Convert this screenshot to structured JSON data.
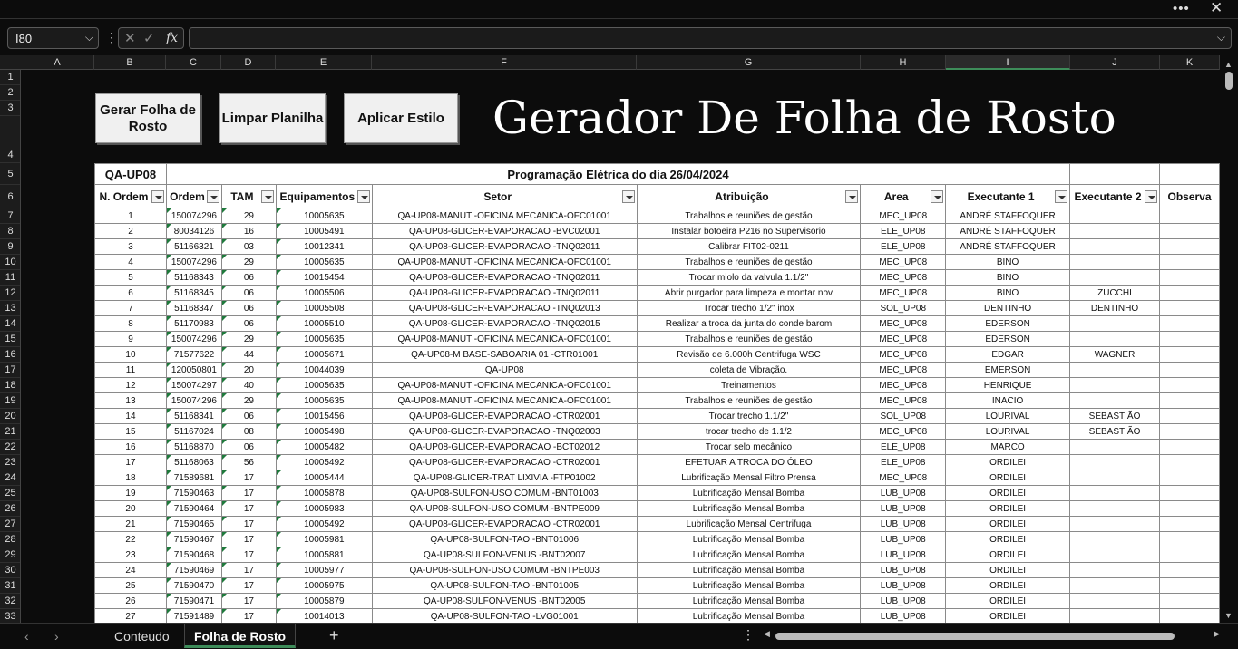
{
  "formula_bar": {
    "name_box": "I80",
    "fx_label": "fx"
  },
  "columns": [
    "A",
    "B",
    "C",
    "D",
    "E",
    "F",
    "G",
    "H",
    "I",
    "J",
    "K"
  ],
  "selected_column": "I",
  "row_numbers": [
    "1",
    "2",
    "3",
    "4",
    "5",
    "6",
    "7",
    "8",
    "9",
    "10",
    "11",
    "12",
    "13",
    "14",
    "15",
    "16",
    "17",
    "18",
    "19",
    "20",
    "21",
    "22",
    "23",
    "24",
    "25",
    "26",
    "27",
    "28",
    "29",
    "30",
    "31",
    "32",
    "33"
  ],
  "buttons": {
    "gerar": "Gerar Folha de Rosto",
    "limpar": "Limpar Planilha",
    "aplicar": "Aplicar Estilo"
  },
  "title": "Gerador De Folha de Rosto",
  "header": {
    "unit": "QA-UP08",
    "programacao": "Programação Elétrica do dia 26/04/2024"
  },
  "table_headers": [
    "N. Ordem",
    "Ordem",
    "TAM",
    "Equipamentos",
    "Setor",
    "Atribuição",
    "Area",
    "Executante 1",
    "Executante 2",
    "Observa"
  ],
  "rows": [
    [
      "1",
      "150074296",
      "29",
      "10005635",
      "QA-UP08-MANUT -OFICINA MECANICA-OFC01001",
      "Trabalhos e reuniões de gestão",
      "MEC_UP08",
      "ANDRÉ STAFFOQUER",
      ""
    ],
    [
      "2",
      "80034126",
      "16",
      "10005491",
      "QA-UP08-GLICER-EVAPORACAO    -BVC02001",
      "Instalar botoeira P216 no Supervisorio",
      "ELE_UP08",
      "ANDRÉ STAFFOQUER",
      ""
    ],
    [
      "3",
      "51166321",
      "03",
      "10012341",
      "QA-UP08-GLICER-EVAPORACAO    -TNQ02011",
      "Calibrar FIT02-0211",
      "ELE_UP08",
      "ANDRÉ STAFFOQUER",
      ""
    ],
    [
      "4",
      "150074296",
      "29",
      "10005635",
      "QA-UP08-MANUT -OFICINA MECANICA-OFC01001",
      "Trabalhos e reuniões de gestão",
      "MEC_UP08",
      "BINO",
      ""
    ],
    [
      "5",
      "51168343",
      "06",
      "10015454",
      "QA-UP08-GLICER-EVAPORACAO    -TNQ02011",
      "Trocar miolo da valvula 1.1/2\"",
      "MEC_UP08",
      "BINO",
      ""
    ],
    [
      "6",
      "51168345",
      "06",
      "10005506",
      "QA-UP08-GLICER-EVAPORACAO    -TNQ02011",
      "Abrir purgador para limpeza e montar nov",
      "MEC_UP08",
      "BINO",
      "ZUCCHI"
    ],
    [
      "7",
      "51168347",
      "06",
      "10005508",
      "QA-UP08-GLICER-EVAPORACAO    -TNQ02013",
      "Trocar trecho 1/2\" inox",
      "SOL_UP08",
      "DENTINHO",
      "DENTINHO"
    ],
    [
      "8",
      "51170983",
      "06",
      "10005510",
      "QA-UP08-GLICER-EVAPORACAO    -TNQ02015",
      "Realizar a troca da junta do conde barom",
      "MEC_UP08",
      "EDERSON",
      ""
    ],
    [
      "9",
      "150074296",
      "29",
      "10005635",
      "QA-UP08-MANUT -OFICINA MECANICA-OFC01001",
      "Trabalhos e reuniões de gestão",
      "MEC_UP08",
      "EDERSON",
      ""
    ],
    [
      "10",
      "71577622",
      "44",
      "10005671",
      "QA-UP08-M BASE-SABOARIA 01    -CTR01001",
      "Revisão de 6.000h Centrifuga WSC",
      "MEC_UP08",
      "EDGAR",
      "WAGNER"
    ],
    [
      "11",
      "120050801",
      "20",
      "10044039",
      "QA-UP08",
      "coleta de Vibração.",
      "MEC_UP08",
      "EMERSON",
      ""
    ],
    [
      "12",
      "150074297",
      "40",
      "10005635",
      "QA-UP08-MANUT -OFICINA MECANICA-OFC01001",
      "Treinamentos",
      "MEC_UP08",
      "HENRIQUE",
      ""
    ],
    [
      "13",
      "150074296",
      "29",
      "10005635",
      "QA-UP08-MANUT -OFICINA MECANICA-OFC01001",
      "Trabalhos e reuniões de gestão",
      "MEC_UP08",
      "INACIO",
      ""
    ],
    [
      "14",
      "51168341",
      "06",
      "10015456",
      "QA-UP08-GLICER-EVAPORACAO    -CTR02001",
      "Trocar trecho 1.1/2\"",
      "SOL_UP08",
      "LOURIVAL",
      "SEBASTIÃO"
    ],
    [
      "15",
      "51167024",
      "08",
      "10005498",
      "QA-UP08-GLICER-EVAPORACAO    -TNQ02003",
      "trocar trecho de 1.1/2",
      "MEC_UP08",
      "LOURIVAL",
      "SEBASTIÃO"
    ],
    [
      "16",
      "51168870",
      "06",
      "10005482",
      "QA-UP08-GLICER-EVAPORACAO    -BCT02012",
      "Trocar selo mecânico",
      "ELE_UP08",
      "MARCO",
      ""
    ],
    [
      "17",
      "51168063",
      "56",
      "10005492",
      "QA-UP08-GLICER-EVAPORACAO    -CTR02001",
      "EFETUAR A TROCA DO ÓLEO",
      "ELE_UP08",
      "ORDILEI",
      ""
    ],
    [
      "18",
      "71589681",
      "17",
      "10005444",
      "QA-UP08-GLICER-TRAT LIXIVIA   -FTP01002",
      "Lubrificação Mensal Filtro Prensa",
      "MEC_UP08",
      "ORDILEI",
      ""
    ],
    [
      "19",
      "71590463",
      "17",
      "10005878",
      "QA-UP08-SULFON-USO COMUM     -BNT01003",
      "Lubrificação Mensal Bomba",
      "LUB_UP08",
      "ORDILEI",
      ""
    ],
    [
      "20",
      "71590464",
      "17",
      "10005983",
      "QA-UP08-SULFON-USO COMUM     -BNTPE009",
      "Lubrificação Mensal Bomba",
      "LUB_UP08",
      "ORDILEI",
      ""
    ],
    [
      "21",
      "71590465",
      "17",
      "10005492",
      "QA-UP08-GLICER-EVAPORACAO    -CTR02001",
      "Lubrificação Mensal Centrifuga",
      "LUB_UP08",
      "ORDILEI",
      ""
    ],
    [
      "22",
      "71590467",
      "17",
      "10005981",
      "QA-UP08-SULFON-TAO          -BNT01006",
      "Lubrificação Mensal Bomba",
      "LUB_UP08",
      "ORDILEI",
      ""
    ],
    [
      "23",
      "71590468",
      "17",
      "10005881",
      "QA-UP08-SULFON-VENUS        -BNT02007",
      "Lubrificação Mensal Bomba",
      "LUB_UP08",
      "ORDILEI",
      ""
    ],
    [
      "24",
      "71590469",
      "17",
      "10005977",
      "QA-UP08-SULFON-USO COMUM     -BNTPE003",
      "Lubrificação Mensal Bomba",
      "LUB_UP08",
      "ORDILEI",
      ""
    ],
    [
      "25",
      "71590470",
      "17",
      "10005975",
      "QA-UP08-SULFON-TAO          -BNT01005",
      "Lubrificação Mensal Bomba",
      "LUB_UP08",
      "ORDILEI",
      ""
    ],
    [
      "26",
      "71590471",
      "17",
      "10005879",
      "QA-UP08-SULFON-VENUS        -BNT02005",
      "Lubrificação Mensal Bomba",
      "LUB_UP08",
      "ORDILEI",
      ""
    ],
    [
      "27",
      "71591489",
      "17",
      "10014013",
      "QA-UP08-SULFON-TAO          -LVG01001",
      "Lubrificação Mensal Bomba",
      "LUB_UP08",
      "ORDILEI",
      ""
    ]
  ],
  "sheet_tabs": [
    "Conteudo",
    "Folha de Rosto"
  ],
  "active_tab": "Folha de Rosto"
}
